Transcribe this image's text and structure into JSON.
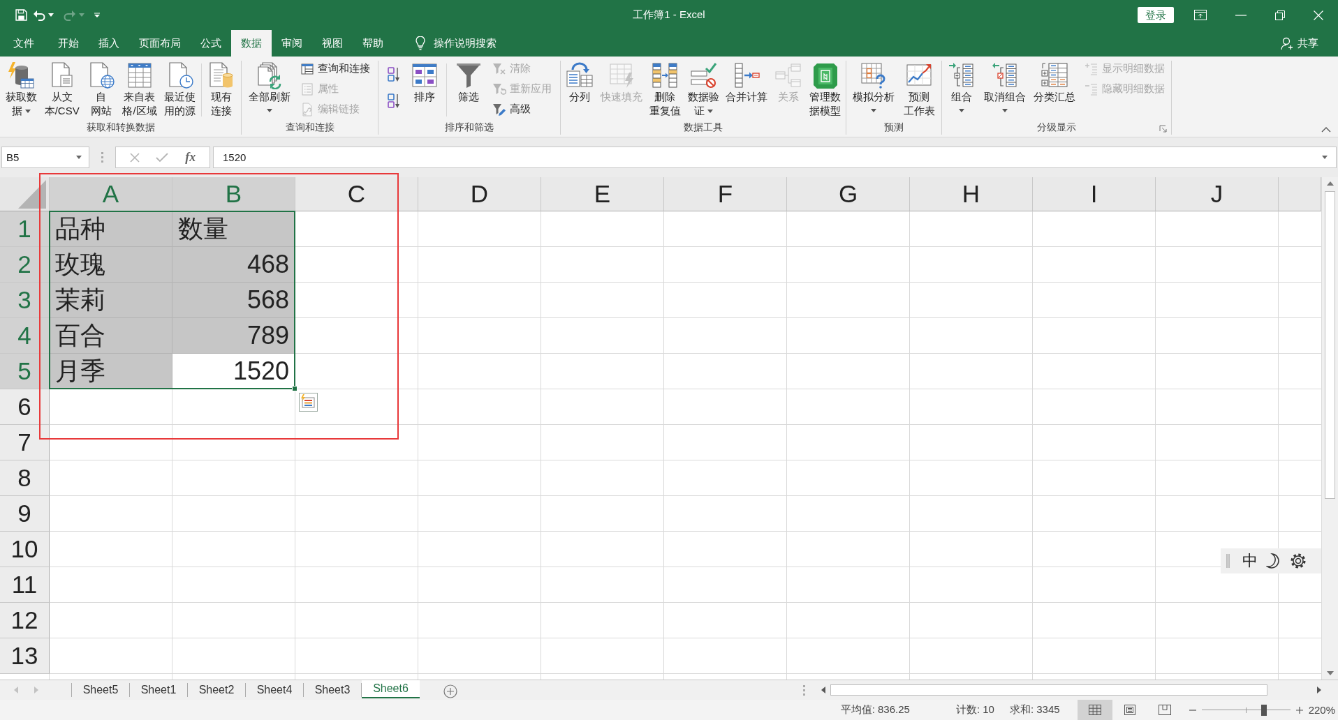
{
  "title_bar": {
    "title": "工作簿1 - Excel",
    "sign_in": "登录",
    "redo_disabled": true
  },
  "menu_tabs": [
    {
      "label": "文件",
      "selected": false
    },
    {
      "label": "开始",
      "selected": false
    },
    {
      "label": "插入",
      "selected": false
    },
    {
      "label": "页面布局",
      "selected": false
    },
    {
      "label": "公式",
      "selected": false
    },
    {
      "label": "数据",
      "selected": true
    },
    {
      "label": "审阅",
      "selected": false
    },
    {
      "label": "视图",
      "selected": false
    },
    {
      "label": "帮助",
      "selected": false
    }
  ],
  "tell_me": "操作说明搜索",
  "share": "共享",
  "ribbon_groups": [
    {
      "label": "获取和转换数据",
      "items": [
        {
          "kind": "large",
          "label": "获取数据",
          "dropdown": true,
          "disabled": false
        },
        {
          "kind": "large",
          "label": "从文本/CSV",
          "dropdown": false,
          "disabled": false
        },
        {
          "kind": "large",
          "label": "自网站",
          "dropdown": false,
          "disabled": false
        },
        {
          "kind": "large",
          "label": "来自表格/区域",
          "dropdown": false,
          "disabled": false
        },
        {
          "kind": "large",
          "label": "最近使用的源",
          "dropdown": false,
          "disabled": false
        },
        {
          "kind": "separator"
        },
        {
          "kind": "large",
          "label": "现有连接",
          "dropdown": false,
          "disabled": false
        }
      ]
    },
    {
      "label": "查询和连接",
      "items": [
        {
          "kind": "large",
          "label": "全部刷新",
          "dropdown": true,
          "disabled": false
        },
        {
          "kind": "stack",
          "items": [
            {
              "label": "查询和连接",
              "disabled": false
            },
            {
              "label": "属性",
              "disabled": true
            },
            {
              "label": "编辑链接",
              "disabled": true
            }
          ]
        }
      ]
    },
    {
      "label": "排序和筛选",
      "items": [
        {
          "kind": "stack",
          "items": [
            {
              "disabled": false
            },
            {
              "disabled": false
            }
          ]
        },
        {
          "kind": "large",
          "label": "排序",
          "dropdown": false,
          "disabled": false
        },
        {
          "kind": "separator"
        },
        {
          "kind": "large",
          "label": "筛选",
          "dropdown": false,
          "disabled": false
        },
        {
          "kind": "stack",
          "items": [
            {
              "label": "清除",
              "disabled": true
            },
            {
              "label": "重新应用",
              "disabled": true
            },
            {
              "label": "高级",
              "disabled": false
            }
          ]
        }
      ]
    },
    {
      "label": "数据工具",
      "items": [
        {
          "kind": "large",
          "label": "分列",
          "dropdown": false,
          "disabled": false
        },
        {
          "kind": "large",
          "label": "快速填充",
          "dropdown": false,
          "disabled": true
        },
        {
          "kind": "large",
          "label": "删除重复值",
          "dropdown": false,
          "disabled": false
        },
        {
          "kind": "large",
          "label": "数据验证",
          "dropdown": true,
          "disabled": false
        },
        {
          "kind": "large",
          "label": "合并计算",
          "dropdown": false,
          "disabled": false
        },
        {
          "kind": "large",
          "label": "关系",
          "dropdown": false,
          "disabled": true
        },
        {
          "kind": "large",
          "label": "管理数据模型",
          "dropdown": false,
          "disabled": false
        }
      ]
    },
    {
      "label": "预测",
      "items": [
        {
          "kind": "large",
          "label": "模拟分析",
          "dropdown": true,
          "disabled": false
        },
        {
          "kind": "large",
          "label": "预测工作表",
          "dropdown": false,
          "disabled": false
        }
      ]
    },
    {
      "label": "分级显示",
      "dialog_launcher": true,
      "items": [
        {
          "kind": "large",
          "label": "组合",
          "dropdown": true,
          "disabled": false
        },
        {
          "kind": "large",
          "label": "取消组合",
          "dropdown": true,
          "disabled": false
        },
        {
          "kind": "large",
          "label": "分类汇总",
          "dropdown": false,
          "disabled": false
        },
        {
          "kind": "stack",
          "items": [
            {
              "label": "显示明细数据",
              "disabled": true
            },
            {
              "label": "隐藏明细数据",
              "disabled": true
            }
          ]
        }
      ]
    }
  ],
  "formula_bar": {
    "name_box": "B5",
    "edit_buttons_disabled": true,
    "function_label": "fx",
    "formula": "1520"
  },
  "sheet": {
    "columns": [
      {
        "label": "A",
        "selected": true
      },
      {
        "label": "B",
        "selected": true
      },
      {
        "label": "C",
        "selected": false
      },
      {
        "label": "D",
        "selected": false
      },
      {
        "label": "E",
        "selected": false
      },
      {
        "label": "F",
        "selected": false
      },
      {
        "label": "G",
        "selected": false
      },
      {
        "label": "H",
        "selected": false
      },
      {
        "label": "I",
        "selected": false
      },
      {
        "label": "J",
        "selected": false
      }
    ],
    "rows": [
      {
        "label": "1",
        "selected": true,
        "cells": [
          {
            "kind": "text",
            "value": "品种",
            "selected": true,
            "active": false
          },
          {
            "kind": "text",
            "value": "数量",
            "selected": true,
            "active": false
          }
        ]
      },
      {
        "label": "2",
        "selected": true,
        "cells": [
          {
            "kind": "text",
            "value": "玫瑰",
            "selected": true,
            "active": false
          },
          {
            "kind": "number",
            "value": "468",
            "selected": true,
            "active": false
          }
        ]
      },
      {
        "label": "3",
        "selected": true,
        "cells": [
          {
            "kind": "text",
            "value": "茉莉",
            "selected": true,
            "active": false
          },
          {
            "kind": "number",
            "value": "568",
            "selected": true,
            "active": false
          }
        ]
      },
      {
        "label": "4",
        "selected": true,
        "cells": [
          {
            "kind": "text",
            "value": "百合",
            "selected": true,
            "active": false
          },
          {
            "kind": "number",
            "value": "789",
            "selected": true,
            "active": false
          }
        ]
      },
      {
        "label": "5",
        "selected": true,
        "cells": [
          {
            "kind": "text",
            "value": "月季",
            "selected": true,
            "active": false
          },
          {
            "kind": "number",
            "value": "1520",
            "selected": true,
            "active": true
          }
        ]
      },
      {
        "label": "6",
        "selected": false
      },
      {
        "label": "7",
        "selected": false
      },
      {
        "label": "8",
        "selected": false
      },
      {
        "label": "9",
        "selected": false
      },
      {
        "label": "10",
        "selected": false
      },
      {
        "label": "11",
        "selected": false
      },
      {
        "label": "12",
        "selected": false
      },
      {
        "label": "13",
        "selected": false
      }
    ]
  },
  "sheet_tabs": [
    {
      "label": "Sheet5",
      "selected": false
    },
    {
      "label": "Sheet1",
      "selected": false
    },
    {
      "label": "Sheet2",
      "selected": false
    },
    {
      "label": "Sheet4",
      "selected": false
    },
    {
      "label": "Sheet3",
      "selected": false
    },
    {
      "label": "Sheet6",
      "selected": true
    }
  ],
  "status_bar": {
    "stats": [
      "平均值: 836.25",
      "计数: 10",
      "求和: 3345"
    ],
    "views": [
      {
        "kind": "normal",
        "selected": true
      },
      {
        "kind": "page_layout",
        "selected": false
      },
      {
        "kind": "page_break",
        "selected": false
      }
    ],
    "zoom": {
      "level": 0.7,
      "label": "220%"
    }
  },
  "ime_toolbar": {
    "mode": "中"
  }
}
